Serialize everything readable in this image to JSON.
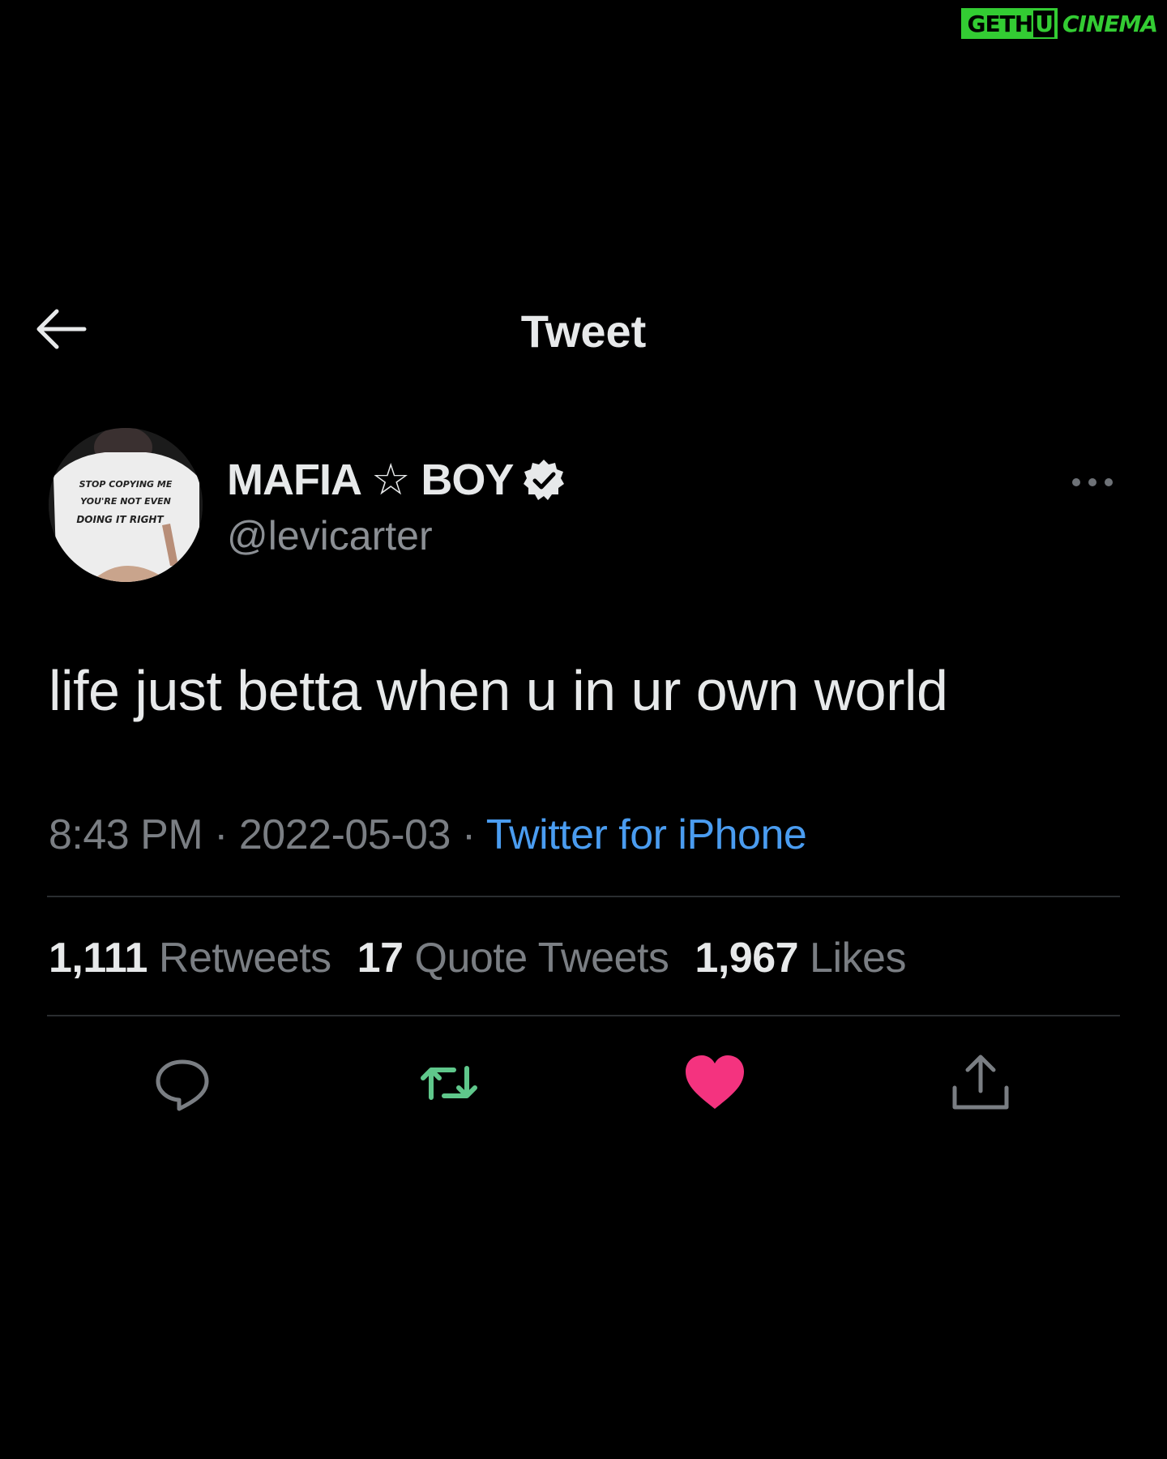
{
  "watermark": {
    "part_a": "GETH",
    "part_a_box": "U",
    "part_b": "CINEMA"
  },
  "header": {
    "title": "Tweet",
    "back_icon": "arrow-left-icon"
  },
  "author": {
    "display_name_left": "MAFIA",
    "display_name_star": "☆",
    "display_name_right": "BOY",
    "handle": "@levicarter",
    "verified": true
  },
  "avatar": {
    "shirt_lines": [
      "STOP COPYING ME",
      "YOU'RE NOT EVEN",
      "DOING IT RIGHT"
    ]
  },
  "tweet": {
    "text": "life just betta when u in ur own world",
    "time": "8:43 PM",
    "separator": "·",
    "date": "2022-05-03",
    "source": "Twitter for iPhone"
  },
  "stats": {
    "retweets_count": "1,111",
    "retweets_label": "Retweets",
    "quotes_count": "17",
    "quotes_label": "Quote Tweets",
    "likes_count": "1,967",
    "likes_label": "Likes"
  },
  "actions": {
    "reply_icon": "reply-icon",
    "retweet_icon": "retweet-icon",
    "like_icon": "heart-icon",
    "share_icon": "share-icon"
  },
  "colors": {
    "background": "#000000",
    "text_primary": "#e7e9ea",
    "text_secondary": "#7a7e83",
    "link": "#4a9cf0",
    "retweet_green": "#5fc78b",
    "like_pink": "#f4337f",
    "watermark_green": "#33cc33"
  }
}
